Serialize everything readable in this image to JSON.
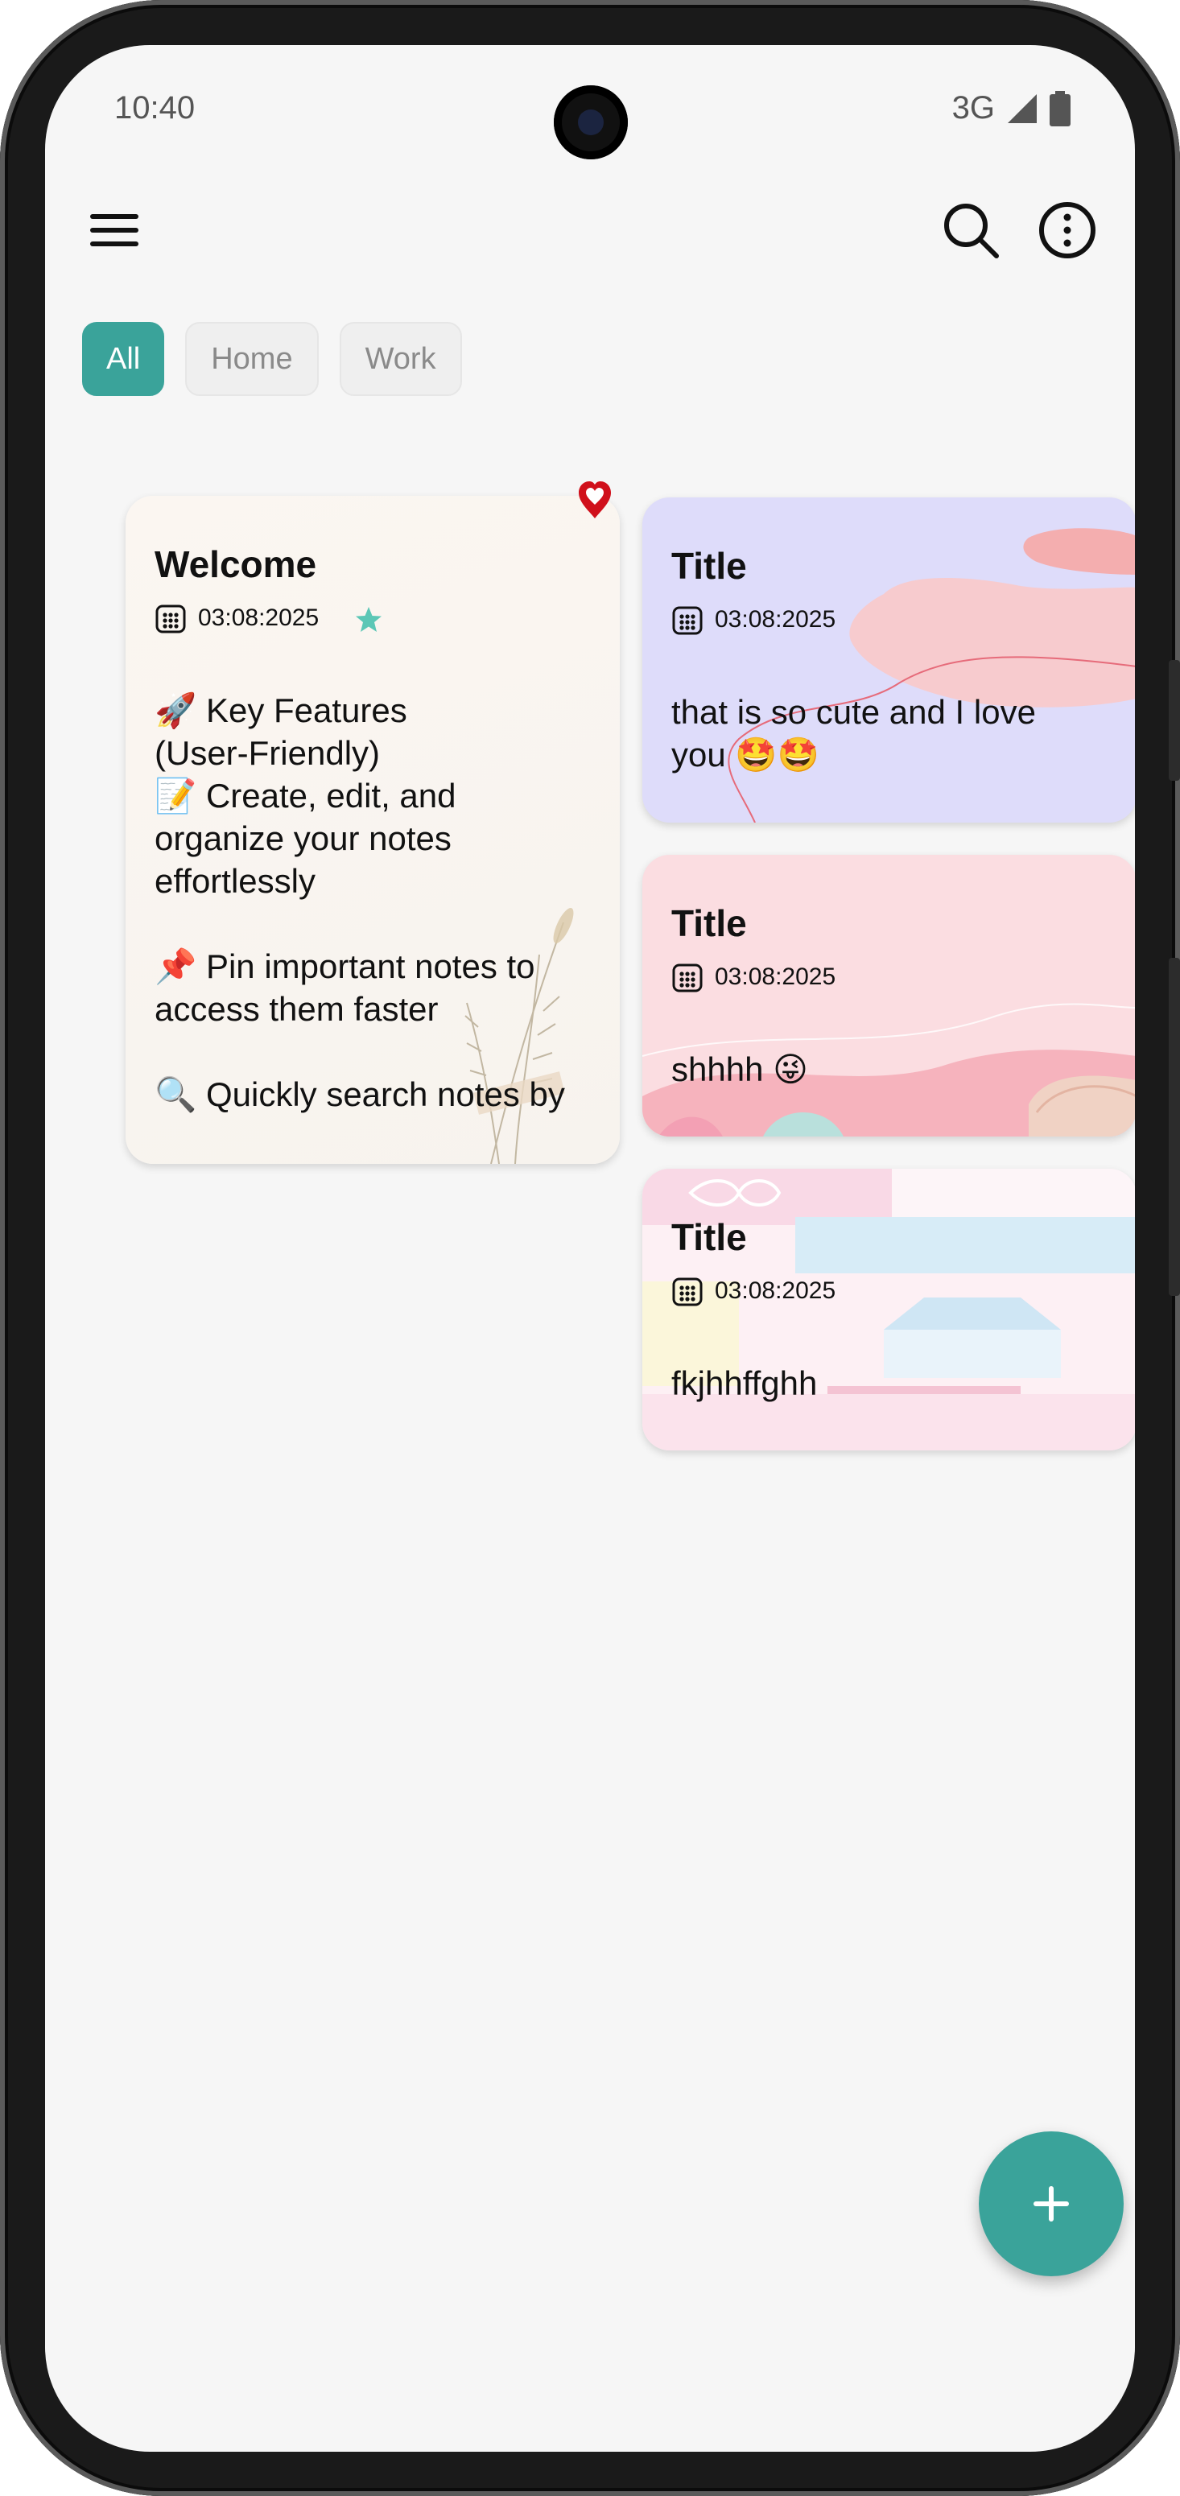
{
  "status": {
    "time": "10:40",
    "network": "3G"
  },
  "filters": [
    {
      "label": "All",
      "active": true
    },
    {
      "label": "Home",
      "active": false
    },
    {
      "label": "Work",
      "active": false
    }
  ],
  "notes": [
    {
      "title": "Welcome",
      "date": "03:08:2025",
      "body": "🚀 Key Features\n(User-Friendly)\n📝 Create, edit, and\norganize your notes\neffortlessly\n\n📌 Pin important notes to\naccess them faster\n\n🔍 Quickly search notes by",
      "favorite": true,
      "starred": true
    },
    {
      "title": "Title",
      "date": "03:08:2025",
      "body": "that is so cute and I love\nyou 🤩🤩"
    },
    {
      "title": "Title",
      "date": "03:08:2025",
      "body": "shhhh 😜"
    },
    {
      "title": "Title",
      "date": "03:08:2025",
      "body": "fkjhhffghh"
    }
  ],
  "colors": {
    "accent": "#3aa39a",
    "heart": "#d0101b",
    "star": "#5cc7b6"
  },
  "icons": [
    "menu-icon",
    "search-icon",
    "more-vertical-icon",
    "calendar-icon",
    "heart-icon",
    "star-icon",
    "plus-icon"
  ]
}
